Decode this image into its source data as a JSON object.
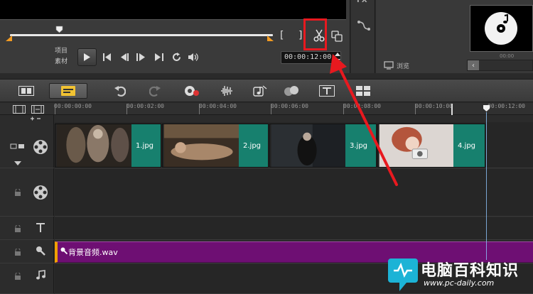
{
  "preview": {
    "mode_project_label": "项目",
    "mode_clip_label": "素材",
    "mark_in_label": "[",
    "mark_out_label": "]",
    "timecode": "00:00:12:00"
  },
  "library": {
    "browse_label": "浏览",
    "thumb_caption": "00:00"
  },
  "fx_strip": {
    "label": "FX"
  },
  "ruler": {
    "ticks": [
      "00:00:00:00",
      "00:00:02:00",
      "00:00:04:00",
      "00:00:06:00",
      "00:00:08:00",
      "00:00:10:00",
      "00:00:12:00"
    ]
  },
  "timeline": {
    "clips": [
      {
        "name": "1.jpg"
      },
      {
        "name": "2.jpg"
      },
      {
        "name": "3.jpg"
      },
      {
        "name": "4.jpg"
      }
    ],
    "audio_clip": {
      "name": "背景音频.wav"
    }
  },
  "watermark": {
    "title": "电脑百科知识",
    "url": "www.pc-daily.com"
  },
  "colors": {
    "photo_clip_tag": "#17806e",
    "audio_clip": "#6e0f73",
    "highlight": "#e8191f"
  },
  "icons": [
    "play-icon",
    "scissors-icon",
    "copy-icon",
    "undo-icon",
    "redo-icon",
    "record-icon",
    "audio-mix-icon",
    "auto-music-icon",
    "motion-tracking-icon",
    "title-icon",
    "multi-cam-icon"
  ]
}
